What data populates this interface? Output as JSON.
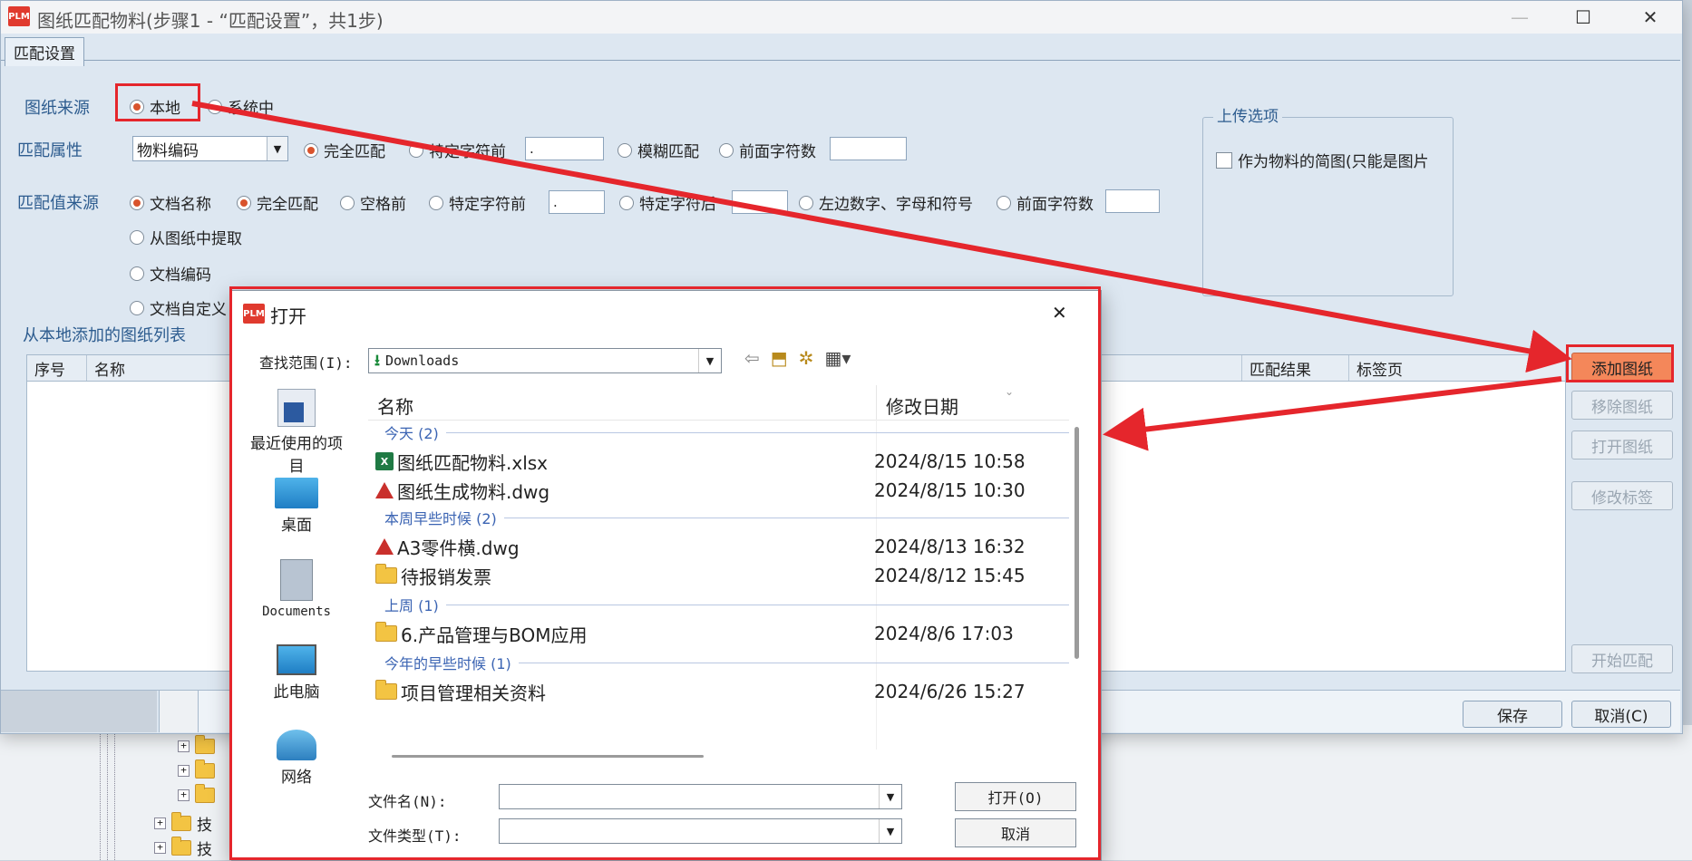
{
  "window": {
    "title": "图纸匹配物料(步骤1 - “匹配设置”，共1步)",
    "logo": "PLM",
    "controls": {
      "minimize": "—",
      "maximize": "☐",
      "close": "✕"
    }
  },
  "tab": {
    "label": "匹配设置"
  },
  "source": {
    "label": "图纸来源",
    "options": [
      {
        "label": "本地",
        "selected": true
      },
      {
        "label": "系统中",
        "selected": false
      }
    ]
  },
  "match_attr": {
    "label": "匹配属性",
    "combo_value": "物料编码",
    "options": [
      {
        "label": "完全匹配",
        "selected": true
      },
      {
        "label": "特定字符前",
        "selected": false
      },
      {
        "label": "模糊匹配",
        "selected": false
      },
      {
        "label": "前面字符数",
        "selected": false
      }
    ],
    "char_value": "."
  },
  "match_value_source": {
    "label": "匹配值来源",
    "options": [
      {
        "label": "文档名称",
        "selected": true
      },
      {
        "label": "从图纸中提取",
        "selected": false
      },
      {
        "label": "文档编码",
        "selected": false
      },
      {
        "label": "文档自定义",
        "selected": false
      }
    ],
    "sub_options": [
      {
        "label": "完全匹配",
        "selected": true
      },
      {
        "label": "空格前",
        "selected": false
      },
      {
        "label": "特定字符前",
        "selected": false
      },
      {
        "label": "特定字符后",
        "selected": false
      },
      {
        "label": "左边数字、字母和符号",
        "selected": false
      },
      {
        "label": "前面字符数",
        "selected": false
      }
    ],
    "char_before_value": ".",
    "char_after_value": ""
  },
  "upload_options": {
    "title": "上传选项",
    "checkbox_label": "作为物料的简图(只能是图片",
    "checked": false
  },
  "list": {
    "title": "从本地添加的图纸列表",
    "columns": [
      "序号",
      "名称",
      "匹配结果",
      "标签页"
    ]
  },
  "side_buttons": {
    "add": "添加图纸",
    "remove": "移除图纸",
    "open": "打开图纸",
    "edit_tag": "修改标签",
    "start": "开始匹配"
  },
  "bottom_buttons": {
    "save": "保存",
    "cancel": "取消(C)"
  },
  "bg_tree": {
    "labels": [
      "技",
      "技"
    ]
  },
  "open_dialog": {
    "title": "打开",
    "close": "✕",
    "lookin_label": "查找范围(I):",
    "lookin_value": "Downloads",
    "places": [
      "最近使用的项目",
      "桌面",
      "Documents",
      "此电脑",
      "网络"
    ],
    "headers": {
      "name": "名称",
      "date": "修改日期"
    },
    "groups": [
      {
        "label": "今天 (2)",
        "files": [
          {
            "name": "图纸匹配物料.xlsx",
            "date": "2024/8/15 10:58",
            "type": "xlsx"
          },
          {
            "name": "图纸生成物料.dwg",
            "date": "2024/8/15 10:30",
            "type": "dwg"
          }
        ]
      },
      {
        "label": "本周早些时候 (2)",
        "files": [
          {
            "name": "A3零件横.dwg",
            "date": "2024/8/13 16:32",
            "type": "dwg"
          },
          {
            "name": "待报销发票",
            "date": "2024/8/12 15:45",
            "type": "folder"
          }
        ]
      },
      {
        "label": "上周 (1)",
        "files": [
          {
            "name": "6.产品管理与BOM应用",
            "date": "2024/8/6 17:03",
            "type": "folder"
          }
        ]
      },
      {
        "label": "今年的早些时候 (1)",
        "files": [
          {
            "name": "项目管理相关资料",
            "date": "2024/6/26 15:27",
            "type": "folder"
          }
        ]
      }
    ],
    "filename_label": "文件名(N):",
    "filetype_label": "文件类型(T):",
    "filename_value": "",
    "filetype_value": "",
    "open_button": "打开(O)",
    "cancel_button": "取消"
  },
  "annotation_color": "#e5262c"
}
